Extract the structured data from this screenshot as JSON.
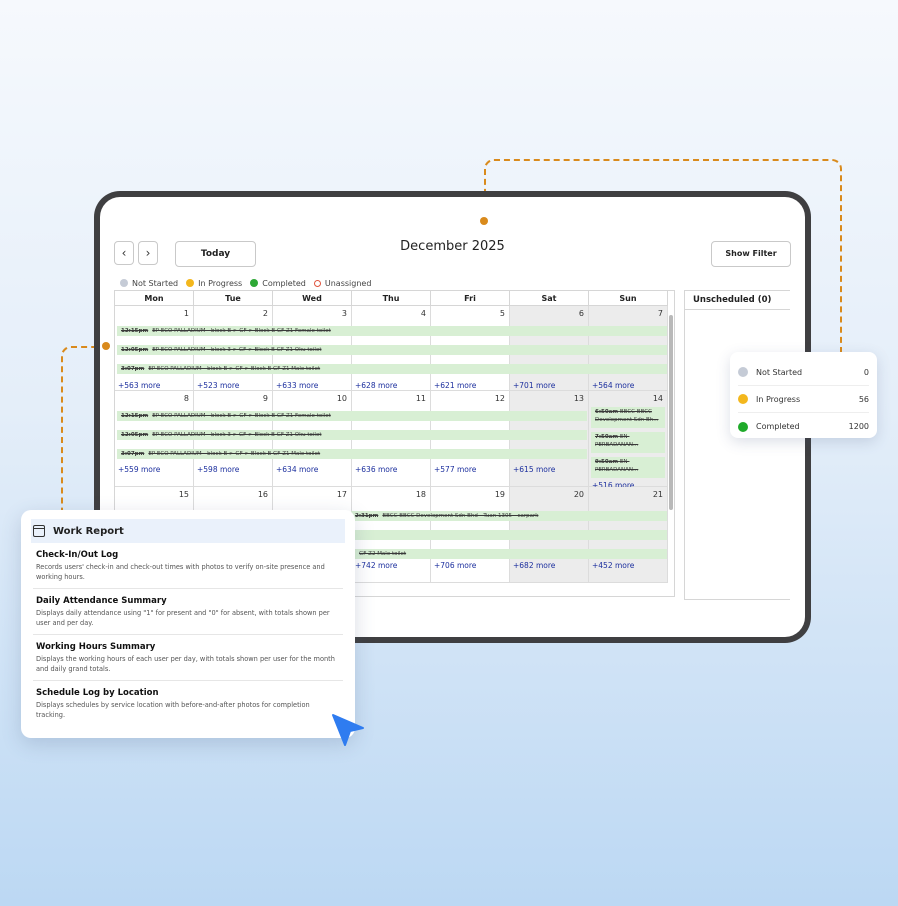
{
  "calendar": {
    "month_title": "December 2025",
    "prev_label": "‹",
    "next_label": "›",
    "today_label": "Today",
    "filter_label": "Show Filter",
    "legend": [
      {
        "label": "Not Started",
        "color": "#c5cbd6"
      },
      {
        "label": "In Progress",
        "color": "#f3b71d"
      },
      {
        "label": "Completed",
        "color": "#2ea836"
      },
      {
        "label": "Unassigned",
        "color": "#e0553f"
      }
    ],
    "days": [
      "Mon",
      "Tue",
      "Wed",
      "Thu",
      "Fri",
      "Sat",
      "Sun"
    ],
    "weeks": [
      {
        "dates": [
          "1",
          "2",
          "3",
          "4",
          "5",
          "6",
          "7"
        ],
        "more": [
          "+563 more",
          "+523 more",
          "+633 more",
          "+628 more",
          "+621 more",
          "+701 more",
          "+564 more"
        ]
      },
      {
        "dates": [
          "8",
          "9",
          "10",
          "11",
          "12",
          "13",
          "14"
        ],
        "more": [
          "+559 more",
          "+598 more",
          "+634 more",
          "+636 more",
          "+577 more",
          "+615 more",
          "+516 more"
        ]
      },
      {
        "dates": [
          "15",
          "16",
          "17",
          "18",
          "19",
          "20",
          "21"
        ],
        "more": [
          "",
          "",
          "",
          "+742 more",
          "+706 more",
          "+682 more",
          "+452 more"
        ]
      }
    ],
    "week1_events": [
      {
        "time": "12:15pm",
        "text": "EP ECO PALLADIUM - block B > GF > Block B GF Z1 Female toilet"
      },
      {
        "time": "12:05pm",
        "text": "EP ECO PALLADIUM - block 3 > GF > Block B GF Z1 Oku toilet"
      },
      {
        "time": "3:07pm",
        "text": "EP ECO PALLADIUM - block B > GF > Block B GF Z1 Male toilet"
      }
    ],
    "week2_events": [
      {
        "time": "12:15pm",
        "text": "EP ECO PALLADIUM - block B > GF > Block B GF Z1 Female toilet"
      },
      {
        "time": "12:05pm",
        "text": "EP ECO PALLADIUM - block 3 > GF > Block B GF Z1 Oku toilet"
      },
      {
        "time": "3:07pm",
        "text": "EP ECO PALLADIUM - block B > GF > Block B GF Z1 Male toilet"
      }
    ],
    "sunday_events": [
      {
        "time": "6:50am",
        "text": "BBCC-BBCC Development Sdn Bh..."
      },
      {
        "time": "7:50am",
        "text": "EN- PERBADANAN..."
      },
      {
        "time": "9:50am",
        "text": "EN- PERBADANAN..."
      }
    ],
    "week3_events": [
      {
        "time": "2:31pm",
        "text": "BBCC-BBCC Development Sdn Bhd - Tuan 1305 - carpark"
      },
      {
        "time": "",
        "text": ""
      },
      {
        "time": "",
        "text": "GF Z2 Male toilet"
      }
    ],
    "unscheduled_label": "Unscheduled (0)"
  },
  "status_summary": [
    {
      "label": "Not Started",
      "count": "0",
      "color": "#c5cbd6"
    },
    {
      "label": "In Progress",
      "count": "56",
      "color": "#f3b71d"
    },
    {
      "label": "Completed",
      "count": "1200",
      "color": "#1faa2a"
    }
  ],
  "report": {
    "title": "Work Report",
    "items": [
      {
        "title": "Check-In/Out Log",
        "desc": "Records users' check-in and check-out times with photos to verify on-site presence and working hours."
      },
      {
        "title": "Daily Attendance Summary",
        "desc": "Displays daily attendance using \"1\" for present and \"0\" for absent, with totals shown per user and per day."
      },
      {
        "title": "Working Hours Summary",
        "desc": "Displays the working hours of each user per day, with totals shown per user for the month and daily grand totals."
      },
      {
        "title": "Schedule Log by Location",
        "desc": "Displays schedules by service location with before-and-after photos for completion tracking."
      }
    ]
  }
}
